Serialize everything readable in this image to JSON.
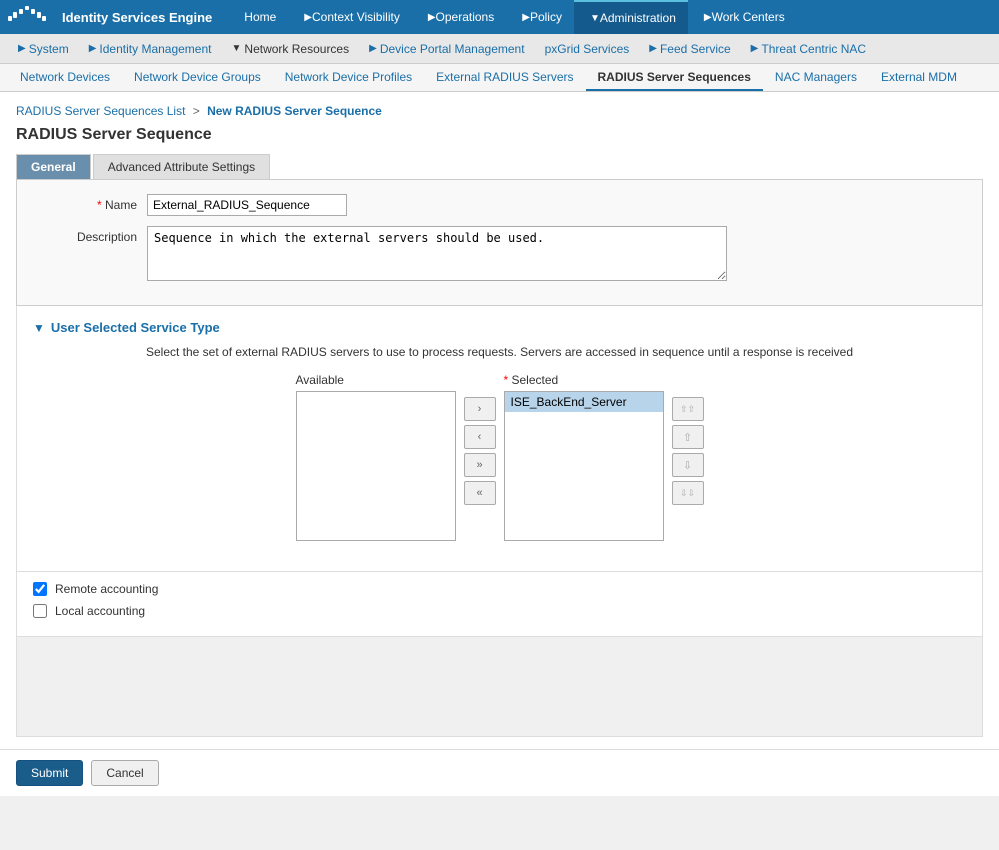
{
  "app": {
    "title": "Identity Services Engine",
    "logo_alt": "Cisco"
  },
  "top_nav": {
    "items": [
      {
        "id": "home",
        "label": "Home",
        "active": false,
        "has_arrow": false
      },
      {
        "id": "context-visibility",
        "label": "Context Visibility",
        "active": false,
        "has_arrow": true
      },
      {
        "id": "operations",
        "label": "Operations",
        "active": false,
        "has_arrow": true
      },
      {
        "id": "policy",
        "label": "Policy",
        "active": false,
        "has_arrow": true
      },
      {
        "id": "administration",
        "label": "Administration",
        "active": true,
        "has_arrow": true
      },
      {
        "id": "work-centers",
        "label": "Work Centers",
        "active": false,
        "has_arrow": true
      }
    ]
  },
  "second_nav": {
    "items": [
      {
        "id": "system",
        "label": "System",
        "has_arrow": true
      },
      {
        "id": "identity-management",
        "label": "Identity Management",
        "has_arrow": true
      },
      {
        "id": "network-resources",
        "label": "Network Resources",
        "has_arrow": true,
        "active": true
      },
      {
        "id": "device-portal-management",
        "label": "Device Portal Management",
        "has_arrow": true
      },
      {
        "id": "pxgrid-services",
        "label": "pxGrid Services",
        "has_arrow": false
      },
      {
        "id": "feed-service",
        "label": "Feed Service",
        "has_arrow": true
      },
      {
        "id": "threat-centric-nac",
        "label": "Threat Centric NAC",
        "has_arrow": true
      }
    ]
  },
  "third_nav": {
    "items": [
      {
        "id": "network-devices",
        "label": "Network Devices",
        "active": false
      },
      {
        "id": "network-device-groups",
        "label": "Network Device Groups",
        "active": false
      },
      {
        "id": "network-device-profiles",
        "label": "Network Device Profiles",
        "active": false
      },
      {
        "id": "external-radius-servers",
        "label": "External RADIUS Servers",
        "active": false
      },
      {
        "id": "radius-server-sequences",
        "label": "RADIUS Server Sequences",
        "active": true
      },
      {
        "id": "nac-managers",
        "label": "NAC Managers",
        "active": false
      },
      {
        "id": "external-mdm",
        "label": "External MDM",
        "active": false
      }
    ]
  },
  "breadcrumb": {
    "parent_label": "RADIUS Server Sequences List",
    "separator": ">",
    "current_label": "New RADIUS Server Sequence"
  },
  "page_title": "RADIUS Server Sequence",
  "form_tabs": [
    {
      "id": "general",
      "label": "General",
      "active": true
    },
    {
      "id": "advanced",
      "label": "Advanced Attribute Settings",
      "active": false
    }
  ],
  "form_fields": {
    "name_label": "* Name",
    "name_required": "*",
    "name_value": "External_RADIUS_Sequence",
    "description_label": "Description",
    "description_value": "Sequence in which the external servers should be used."
  },
  "user_selected_section": {
    "title": "User Selected Service Type",
    "description": "Select the set of external RADIUS servers to use to process requests. Servers are accessed in sequence until a response is received",
    "available_label": "Available",
    "selected_label": "* Selected",
    "available_items": [],
    "selected_items": [
      "ISE_BackEnd_Server"
    ],
    "transfer_buttons": [
      {
        "id": "move-right",
        "label": "›"
      },
      {
        "id": "move-left",
        "label": "‹"
      },
      {
        "id": "move-all-right",
        "label": "»"
      },
      {
        "id": "move-all-left",
        "label": "«"
      }
    ],
    "order_buttons": [
      {
        "id": "move-top",
        "label": "⇈"
      },
      {
        "id": "move-up",
        "label": "↑"
      },
      {
        "id": "move-down",
        "label": "↓"
      },
      {
        "id": "move-bottom",
        "label": "⇊"
      }
    ]
  },
  "checkboxes": [
    {
      "id": "remote-accounting",
      "label": "Remote accounting",
      "checked": true
    },
    {
      "id": "local-accounting",
      "label": "Local accounting",
      "checked": false
    }
  ],
  "bottom_buttons": {
    "submit_label": "Submit",
    "cancel_label": "Cancel"
  }
}
